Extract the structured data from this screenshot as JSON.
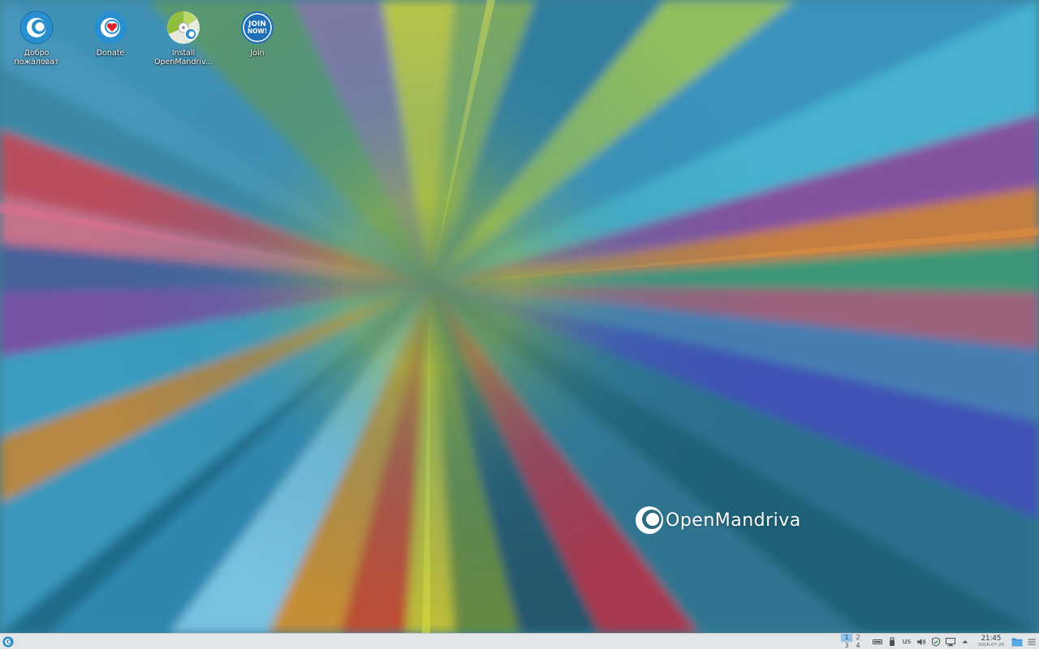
{
  "desktop": {
    "icons": [
      {
        "label": "Добро пожаловат",
        "icon": "openmandriva-welcome-icon"
      },
      {
        "label": "Donate",
        "icon": "donate-heart-icon"
      },
      {
        "label": "Install OpenMandriv...",
        "icon": "install-disc-icon"
      },
      {
        "label": "Join",
        "icon": "join-now-icon"
      }
    ],
    "brand": {
      "logo_text": "OpenMandriva",
      "color": "#ffffff"
    }
  },
  "taskbar": {
    "launcher_icon": "openmandriva-launcher-icon",
    "pager": {
      "desktops": [
        "1",
        "2",
        "3",
        "4"
      ],
      "active_index": 0,
      "active_color": "#93c2e6"
    },
    "tray": {
      "items": [
        "keyboard-icon",
        "usb-drive-icon",
        "keyboard-layout",
        "volume-icon",
        "shield-update-icon",
        "network-monitor-icon",
        "expand-tray-arrow-icon"
      ],
      "keyboard_layout": "us"
    },
    "clock": {
      "time": "21:45",
      "date": "2016-07-20"
    },
    "show_desktop_icon": "show-desktop-folder-icon",
    "menu_icon": "hamburger-menu-icon"
  },
  "colors": {
    "taskbar_bg": "#e3e6e8",
    "accent_blue": "#1e88c7"
  }
}
